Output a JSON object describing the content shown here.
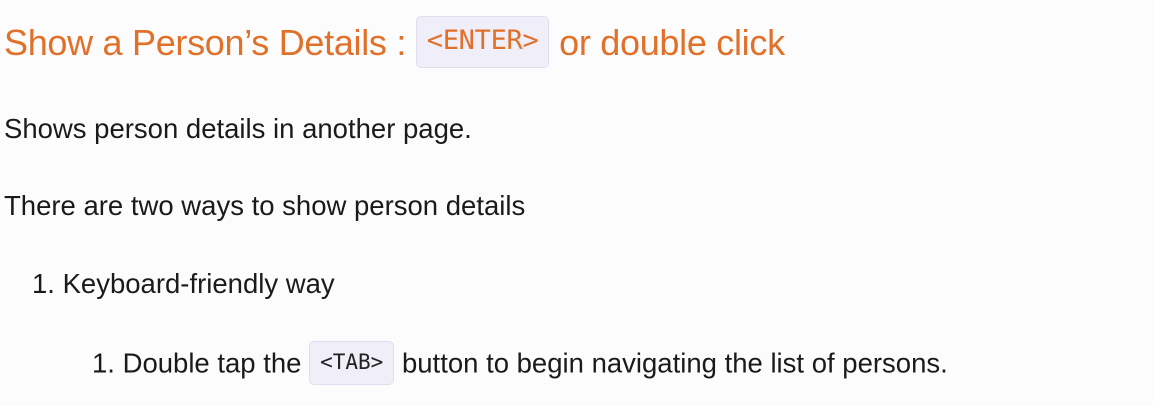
{
  "heading": {
    "text": "Show a Person’s Details :",
    "key": "<ENTER>",
    "suffix": "or double click"
  },
  "paragraphs": [
    "Shows person details in another page.",
    "There are two ways to show person details"
  ],
  "list": {
    "item1": {
      "number": "1.",
      "text": "Keyboard-friendly way"
    },
    "item1_sub1": {
      "number": "1.",
      "before": "Double tap the",
      "key": "<TAB>",
      "after": "button to begin navigating the list of persons."
    }
  }
}
